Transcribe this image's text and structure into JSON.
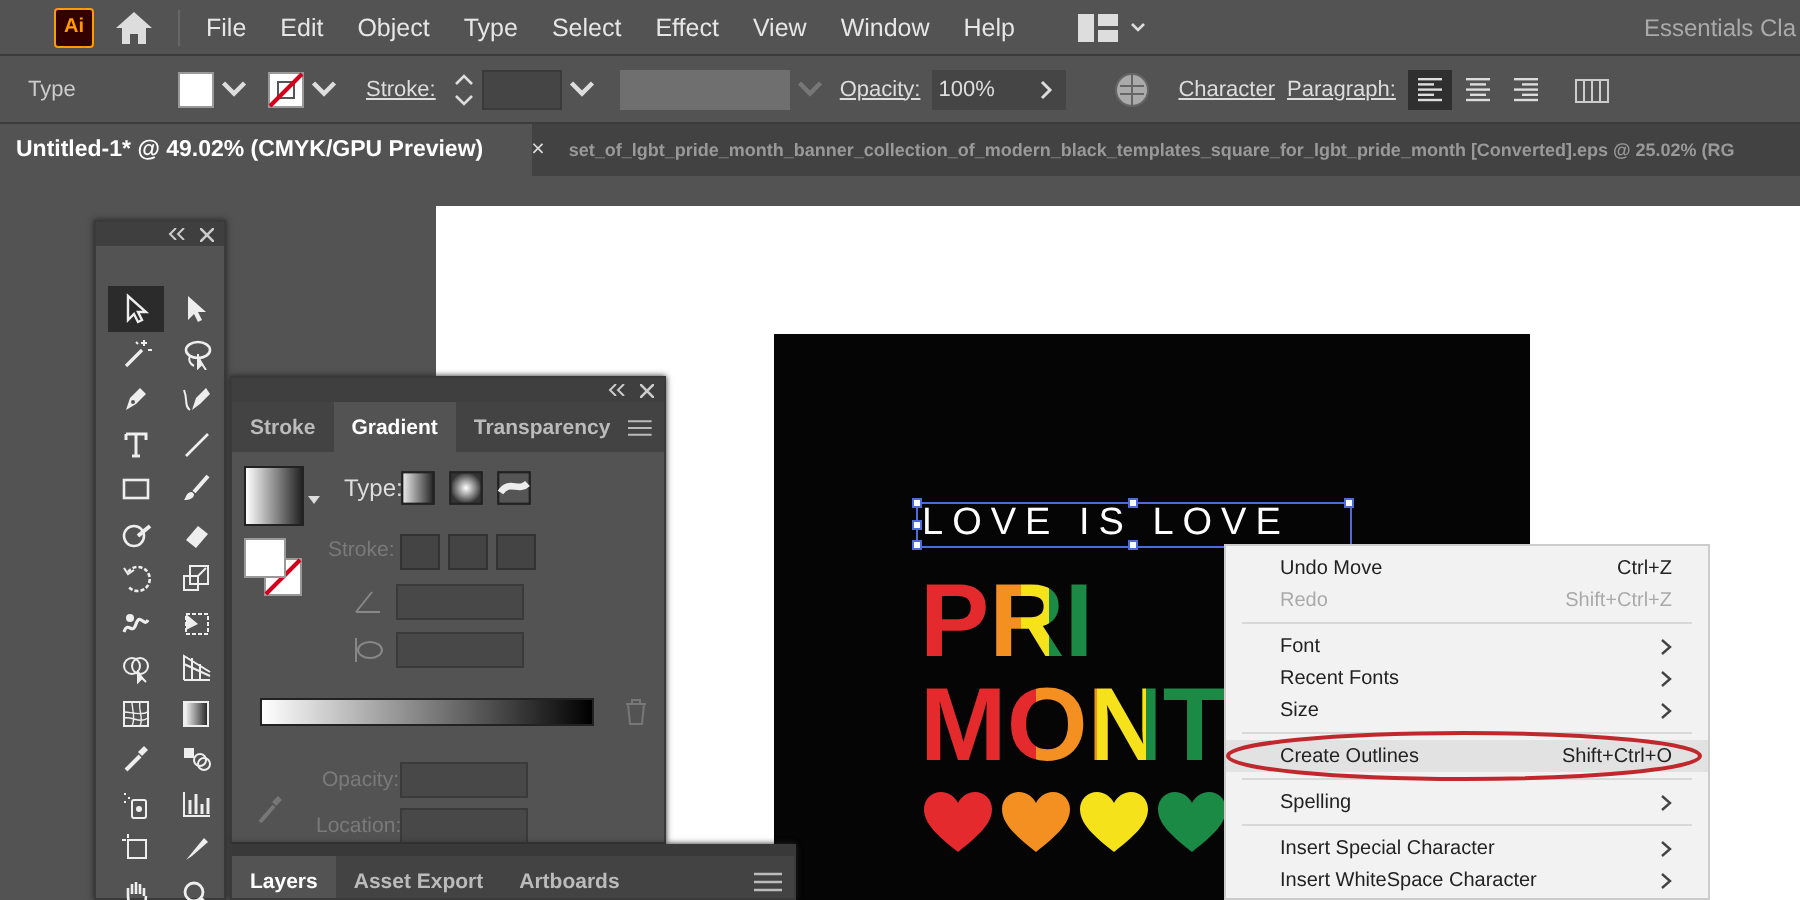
{
  "app": {
    "logo": "Ai"
  },
  "menu_bar": {
    "items": [
      "File",
      "Edit",
      "Object",
      "Type",
      "Select",
      "Effect",
      "View",
      "Window",
      "Help"
    ],
    "workspace": "Essentials Cla"
  },
  "control_bar": {
    "label": "Type",
    "stroke_label": "Stroke:",
    "opacity_label": "Opacity:",
    "opacity": "100%",
    "character": "Character",
    "paragraph": "Paragraph:",
    "align": [
      {
        "kind": "left",
        "selected": true
      },
      {
        "kind": "center",
        "selected": false
      },
      {
        "kind": "right",
        "selected": false
      }
    ]
  },
  "document_tabs": [
    {
      "label": "Untitled-1* @ 49.02% (CMYK/GPU Preview)",
      "selected": true,
      "close": "×"
    },
    {
      "label": "set_of_lgbt_pride_month_banner_collection_of_modern_black_templates_square_for_lgbt_pride_month [Converted].eps @ 25.02% (RG",
      "selected": false
    }
  ],
  "tools_panel": {
    "tools": [
      {
        "kind": "selection",
        "selected": true
      },
      {
        "kind": "direct",
        "selected": false
      },
      {
        "kind": "wand",
        "selected": false
      },
      {
        "kind": "lasso",
        "selected": false
      },
      {
        "kind": "pen",
        "selected": false
      },
      {
        "kind": "curvature",
        "selected": false
      },
      {
        "kind": "type",
        "selected": false
      },
      {
        "kind": "line",
        "selected": false
      },
      {
        "kind": "rectangle",
        "selected": false
      },
      {
        "kind": "brush",
        "selected": false
      },
      {
        "kind": "shaper",
        "selected": false
      },
      {
        "kind": "eraser",
        "selected": false
      },
      {
        "kind": "rotate",
        "selected": false
      },
      {
        "kind": "scale",
        "selected": false
      },
      {
        "kind": "warp",
        "selected": false
      },
      {
        "kind": "transform",
        "selected": false
      },
      {
        "kind": "builder",
        "selected": false
      },
      {
        "kind": "perspective",
        "selected": false
      },
      {
        "kind": "mesh",
        "selected": false
      },
      {
        "kind": "gradient",
        "selected": false
      },
      {
        "kind": "eyedropper",
        "selected": false
      },
      {
        "kind": "blend",
        "selected": false
      },
      {
        "kind": "sprayer",
        "selected": false
      },
      {
        "kind": "graph",
        "selected": false
      },
      {
        "kind": "artboard",
        "selected": false
      },
      {
        "kind": "slice",
        "selected": false
      },
      {
        "kind": "hand",
        "selected": false
      },
      {
        "kind": "zoom",
        "selected": false
      }
    ]
  },
  "gradient_panel": {
    "tabs": [
      {
        "label": "Stroke",
        "selected": false
      },
      {
        "label": "Gradient",
        "selected": true
      },
      {
        "label": "Transparency",
        "selected": false
      }
    ],
    "type_label": "Type:",
    "stroke_label": "Stroke:",
    "opacity_label": "Opacity:",
    "location_label": "Location:"
  },
  "layers_panel": {
    "tabs": [
      {
        "label": "Layers",
        "selected": true
      },
      {
        "label": "Asset Export",
        "selected": false
      },
      {
        "label": "Artboards",
        "selected": false
      }
    ]
  },
  "artwork": {
    "tagline": "LOVE IS LOVE",
    "line1": "PRI",
    "line2": "MONT",
    "hearts": [
      {
        "color": "#e52a2e"
      },
      {
        "color": "#f39021"
      },
      {
        "color": "#f5e21a"
      },
      {
        "color": "#1a8a45"
      }
    ]
  },
  "context_menu": {
    "items": [
      {
        "kind": "item",
        "label": "Undo Move",
        "shortcut": "Ctrl+Z",
        "disabled": false,
        "submenu": false,
        "highlighted": false,
        "circled": false
      },
      {
        "kind": "item",
        "label": "Redo",
        "shortcut": "Shift+Ctrl+Z",
        "disabled": true,
        "submenu": false,
        "highlighted": false,
        "circled": false
      },
      {
        "kind": "separator"
      },
      {
        "kind": "item",
        "label": "Font",
        "disabled": false,
        "submenu": true,
        "highlighted": false,
        "circled": false
      },
      {
        "kind": "item",
        "label": "Recent Fonts",
        "disabled": false,
        "submenu": true,
        "highlighted": false,
        "circled": false
      },
      {
        "kind": "item",
        "label": "Size",
        "disabled": false,
        "submenu": true,
        "highlighted": false,
        "circled": false
      },
      {
        "kind": "separator"
      },
      {
        "kind": "item",
        "label": "Create Outlines",
        "shortcut": "Shift+Ctrl+O",
        "disabled": false,
        "submenu": false,
        "highlighted": true,
        "circled": true
      },
      {
        "kind": "separator"
      },
      {
        "kind": "item",
        "label": "Spelling",
        "disabled": false,
        "submenu": true,
        "highlighted": false,
        "circled": false
      },
      {
        "kind": "separator"
      },
      {
        "kind": "item",
        "label": "Insert Special Character",
        "disabled": false,
        "submenu": true,
        "highlighted": false,
        "circled": false
      },
      {
        "kind": "item",
        "label": "Insert WhiteSpace Character",
        "disabled": false,
        "submenu": true,
        "highlighted": false,
        "circled": false
      }
    ]
  }
}
